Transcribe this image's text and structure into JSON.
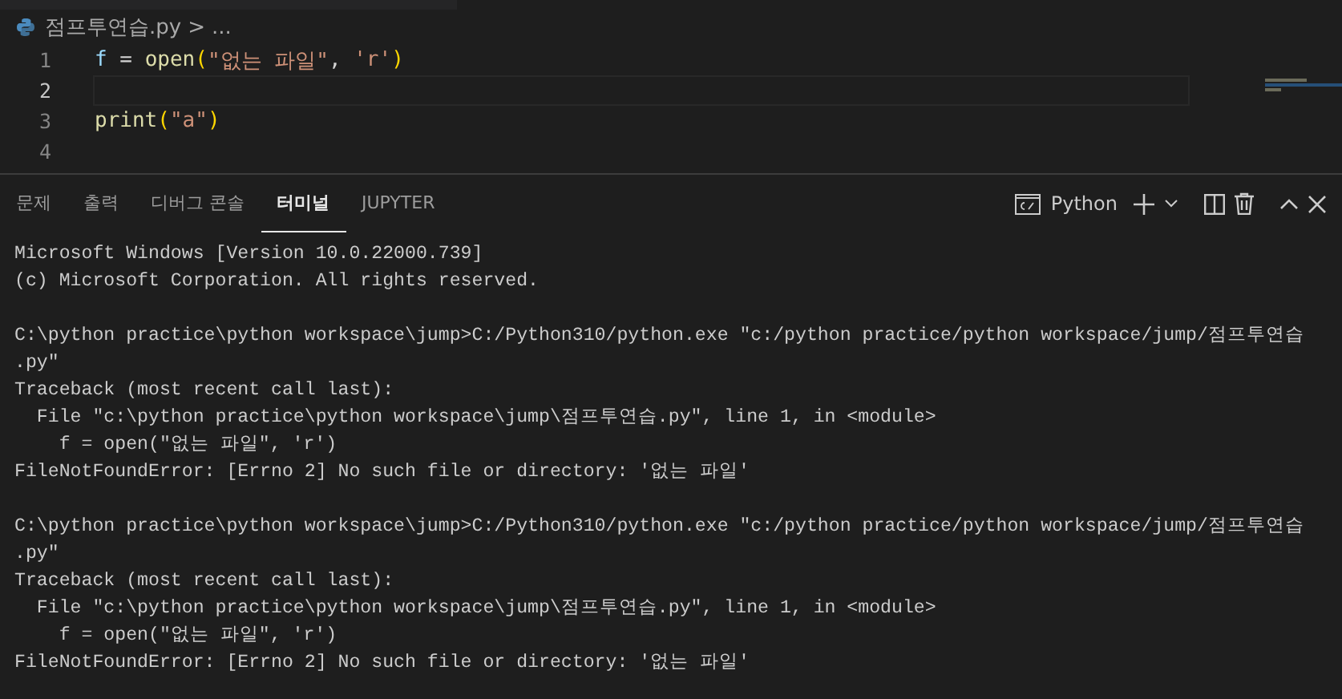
{
  "breadcrumb": {
    "file": "점프투연습.py",
    "separator": ">",
    "rest": "..."
  },
  "editor": {
    "lines": [
      {
        "number": "1",
        "current": false,
        "tokens": [
          {
            "text": "f",
            "kind": "var"
          },
          {
            "text": " = ",
            "kind": "op"
          },
          {
            "text": "open",
            "kind": "func"
          },
          {
            "text": "(",
            "kind": "paren"
          },
          {
            "text": "\"없는 파일\"",
            "kind": "str"
          },
          {
            "text": ", ",
            "kind": "op"
          },
          {
            "text": "'r'",
            "kind": "str"
          },
          {
            "text": ")",
            "kind": "paren"
          }
        ]
      },
      {
        "number": "2",
        "current": true
      },
      {
        "number": "3",
        "current": false,
        "tokens": [
          {
            "text": "print",
            "kind": "func"
          },
          {
            "text": "(",
            "kind": "paren"
          },
          {
            "text": "\"a\"",
            "kind": "str"
          },
          {
            "text": ")",
            "kind": "paren"
          }
        ]
      },
      {
        "number": "4",
        "current": false
      }
    ]
  },
  "panel": {
    "tabs": [
      {
        "label": "문제",
        "selected": false
      },
      {
        "label": "출력",
        "selected": false
      },
      {
        "label": "디버그 콘솔",
        "selected": false
      },
      {
        "label": "터미널",
        "selected": true
      },
      {
        "label": "JUPYTER",
        "selected": false
      }
    ],
    "terminal_name": "Python"
  },
  "terminal": {
    "blocks": [
      [
        "Microsoft Windows [Version 10.0.22000.739]",
        "(c) Microsoft Corporation. All rights reserved."
      ],
      [
        "C:\\python practice\\python workspace\\jump>C:/Python310/python.exe \"c:/python practice/python workspace/jump/점프투연습",
        ".py\"",
        "Traceback (most recent call last):",
        "  File \"c:\\python practice\\python workspace\\jump\\점프투연습.py\", line 1, in <module>",
        "    f = open(\"없는 파일\", 'r')",
        "FileNotFoundError: [Errno 2] No such file or directory: '없는 파일'"
      ],
      [
        "C:\\python practice\\python workspace\\jump>C:/Python310/python.exe \"c:/python practice/python workspace/jump/점프투연습",
        ".py\"",
        "Traceback (most recent call last):",
        "  File \"c:\\python practice\\python workspace\\jump\\점프투연습.py\", line 1, in <module>",
        "    f = open(\"없는 파일\", 'r')",
        "FileNotFoundError: [Errno 2] No such file or directory: '없는 파일'"
      ]
    ]
  }
}
